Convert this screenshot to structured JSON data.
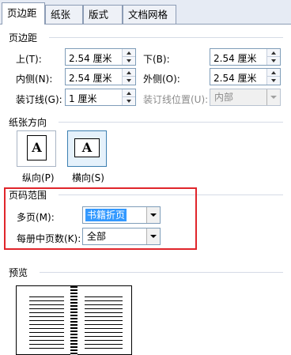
{
  "tabs": [
    {
      "label": "页边距"
    },
    {
      "label": "纸张"
    },
    {
      "label": "版式"
    },
    {
      "label": "文档网格"
    }
  ],
  "margins": {
    "section_title": "页边距",
    "top_label": "上(T):",
    "top_value": "2.54 厘米",
    "bottom_label": "下(B):",
    "bottom_value": "2.54 厘米",
    "inside_label": "内侧(N):",
    "inside_value": "2.54 厘米",
    "outside_label": "外侧(O):",
    "outside_value": "2.54 厘米",
    "gutter_label": "装订线(G):",
    "gutter_value": "1 厘米",
    "gutter_pos_label": "装订线位置(U):",
    "gutter_pos_value": "内部"
  },
  "orientation": {
    "section_title": "纸张方向",
    "portrait_label": "纵向(P)",
    "landscape_label": "横向(S)",
    "icon_letter": "A",
    "selected": "landscape"
  },
  "page_range": {
    "section_title": "页码范围",
    "multiple_pages_label": "多页(M):",
    "multiple_pages_value": "书籍折页",
    "sheets_per_booklet_label": "每册中页数(K):",
    "sheets_per_booklet_value": "全部"
  },
  "preview": {
    "section_title": "预览"
  },
  "colors": {
    "highlight_box": "#e0252b",
    "selection": "#3399ff"
  }
}
